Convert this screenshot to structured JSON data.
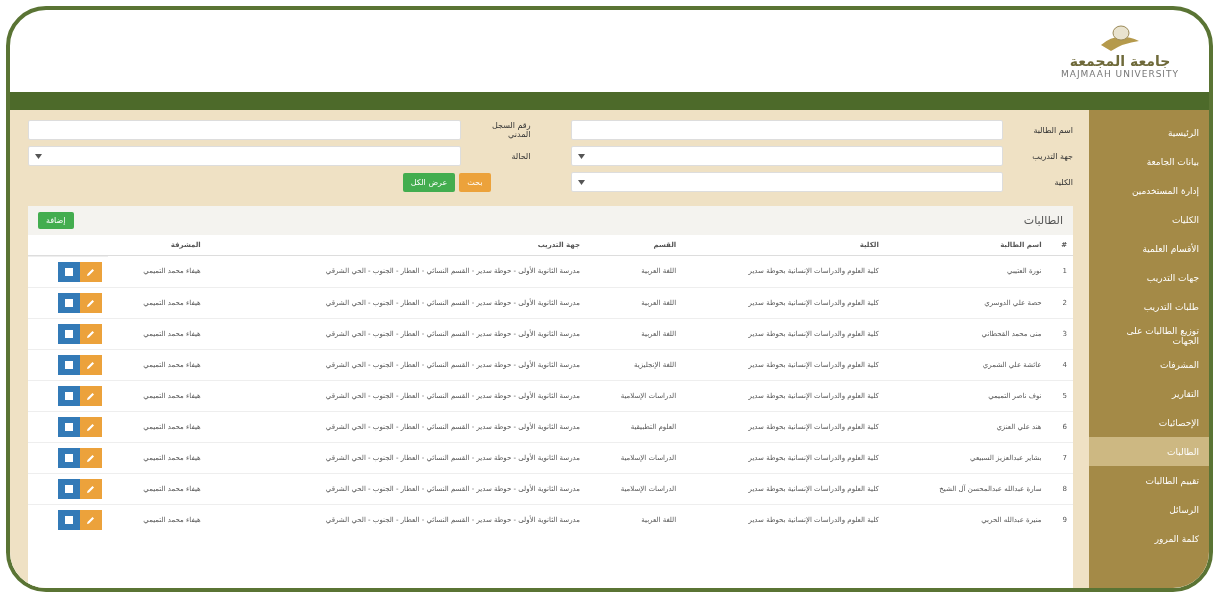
{
  "header": {
    "logo_text": "جامعة المجمعة",
    "logo_subtext": "MAJMAAH UNIVERSITY"
  },
  "sidebar": {
    "items": [
      {
        "label": "الرئيسية",
        "selected": false
      },
      {
        "label": "بيانات الجامعة",
        "selected": false
      },
      {
        "label": "إدارة المستخدمين",
        "selected": false
      },
      {
        "label": "الكليات",
        "selected": false
      },
      {
        "label": "الأقسام العلمية",
        "selected": false
      },
      {
        "label": "جهات التدريب",
        "selected": false
      },
      {
        "label": "طلبات التدريب",
        "selected": false
      },
      {
        "label": "توزيع الطالبات على الجهات",
        "selected": false
      },
      {
        "label": "المشرفات",
        "selected": false
      },
      {
        "label": "التقارير",
        "selected": false
      },
      {
        "label": "الإحصائيات",
        "selected": false
      },
      {
        "label": "الطالبات",
        "selected": true
      },
      {
        "label": "تقييم الطالبات",
        "selected": false
      },
      {
        "label": "الرسائل",
        "selected": false
      },
      {
        "label": "كلمة المرور",
        "selected": false
      }
    ]
  },
  "filters": [
    {
      "label": "اسم الطالبة",
      "kind": "text"
    },
    {
      "label": "جهة التدريب",
      "kind": "select"
    },
    {
      "label": "الكلية",
      "kind": "select"
    },
    {
      "label": "رقم السجل المدني",
      "kind": "text"
    },
    {
      "label": "الحالة",
      "kind": "select"
    }
  ],
  "filter_buttons": {
    "search": "بحث",
    "reset": "عرض الكل"
  },
  "table": {
    "title": "الطالبات",
    "add_button": "إضافة",
    "columns": [
      "#",
      "اسم الطالبة",
      "الكلية",
      "القسم",
      "جهة التدريب",
      "المشرفة"
    ],
    "rows": [
      [
        "1",
        "نورة العتيبي",
        "كلية العلوم والدراسات الإنسانية بحوطة سدير",
        "اللغة العربية",
        "مدرسة الثانوية الأولى - حوطة سدير - القسم النسائي - العطار - الجنوب - الحي الشرقي",
        "هيفاء محمد التميمي"
      ],
      [
        "2",
        "حصة علي الدوسري",
        "كلية العلوم والدراسات الإنسانية بحوطة سدير",
        "اللغة العربية",
        "مدرسة الثانوية الأولى - حوطة سدير - القسم النسائي - العطار - الجنوب - الحي الشرقي",
        "هيفاء محمد التميمي"
      ],
      [
        "3",
        "منى محمد القحطاني",
        "كلية العلوم والدراسات الإنسانية بحوطة سدير",
        "اللغة العربية",
        "مدرسة الثانوية الأولى - حوطة سدير - القسم النسائي - العطار - الجنوب - الحي الشرقي",
        "هيفاء محمد التميمي"
      ],
      [
        "4",
        "عائشة علي الشمري",
        "كلية العلوم والدراسات الإنسانية بحوطة سدير",
        "اللغة الإنجليزية",
        "مدرسة الثانوية الأولى - حوطة سدير - القسم النسائي - العطار - الجنوب - الحي الشرقي",
        "هيفاء محمد التميمي"
      ],
      [
        "5",
        "نوف ناصر التميمي",
        "كلية العلوم والدراسات الإنسانية بحوطة سدير",
        "الدراسات الإسلامية",
        "مدرسة الثانوية الأولى - حوطة سدير - القسم النسائي - العطار - الجنوب - الحي الشرقي",
        "هيفاء محمد التميمي"
      ],
      [
        "6",
        "هند علي العنزي",
        "كلية العلوم والدراسات الإنسانية بحوطة سدير",
        "العلوم التطبيقية",
        "مدرسة الثانوية الأولى - حوطة سدير - القسم النسائي - العطار - الجنوب - الحي الشرقي",
        "هيفاء محمد التميمي"
      ],
      [
        "7",
        "بشاير عبدالعزيز السبيعي",
        "كلية العلوم والدراسات الإنسانية بحوطة سدير",
        "الدراسات الإسلامية",
        "مدرسة الثانوية الأولى - حوطة سدير - القسم النسائي - العطار - الجنوب - الحي الشرقي",
        "هيفاء محمد التميمي"
      ],
      [
        "8",
        "سارة عبدالله عبدالمحسن آل الشيخ",
        "كلية العلوم والدراسات الإنسانية بحوطة سدير",
        "الدراسات الإسلامية",
        "مدرسة الثانوية الأولى - حوطة سدير - القسم النسائي - العطار - الجنوب - الحي الشرقي",
        "هيفاء محمد التميمي"
      ],
      [
        "9",
        "منيرة عبدالله الحربي",
        "كلية العلوم والدراسات الإنسانية بحوطة سدير",
        "اللغة العربية",
        "مدرسة الثانوية الأولى - حوطة سدير - القسم النسائي - العطار - الجنوب - الحي الشرقي",
        "هيفاء محمد التميمي"
      ]
    ]
  }
}
